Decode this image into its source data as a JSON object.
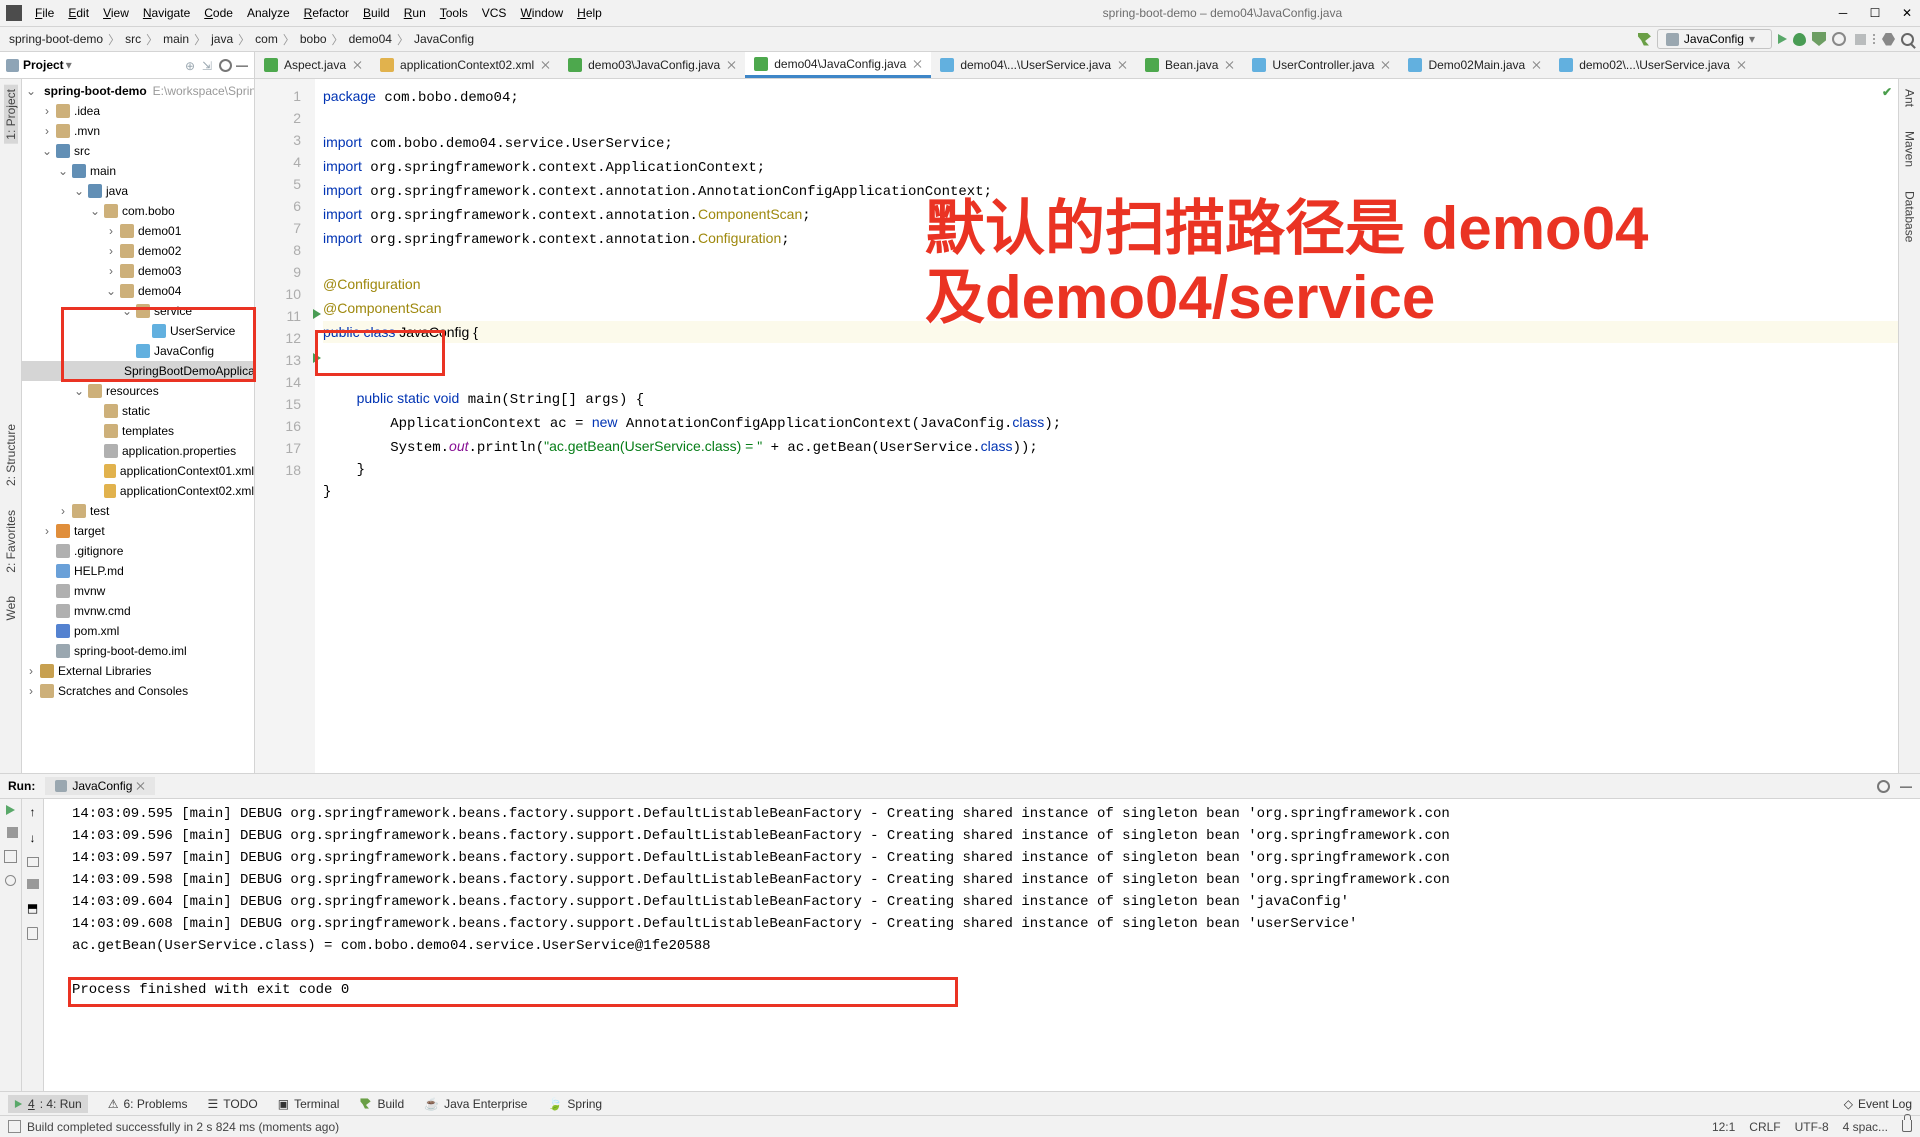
{
  "window_title": "spring-boot-demo – demo04\\JavaConfig.java",
  "menu": [
    "File",
    "Edit",
    "View",
    "Navigate",
    "Code",
    "Analyze",
    "Refactor",
    "Build",
    "Run",
    "Tools",
    "VCS",
    "Window",
    "Help"
  ],
  "menu_underline": [
    "F",
    "E",
    "V",
    "N",
    "C",
    null,
    "R",
    "B",
    "R",
    "T",
    null,
    "W",
    "H"
  ],
  "breadcrumbs": [
    "spring-boot-demo",
    "src",
    "main",
    "java",
    "com",
    "bobo",
    "demo04",
    "JavaConfig"
  ],
  "run_config": "JavaConfig",
  "project_panel_label": "Project",
  "tree": {
    "root": "spring-boot-demo",
    "root_path": "E:\\workspace\\SpringCloud",
    "idea": ".idea",
    "mvn": ".mvn",
    "src": "src",
    "main": "main",
    "java": "java",
    "combobo": "com.bobo",
    "demo01": "demo01",
    "demo02": "demo02",
    "demo03": "demo03",
    "demo04": "demo04",
    "service": "service",
    "userservice": "UserService",
    "javaconfig": "JavaConfig",
    "springbootapp": "SpringBootDemoApplication",
    "resources": "resources",
    "static": "static",
    "templates": "templates",
    "appprops": "application.properties",
    "ctx01": "applicationContext01.xml",
    "ctx02": "applicationContext02.xml",
    "test": "test",
    "target": "target",
    "gitignore": ".gitignore",
    "help": "HELP.md",
    "mvnw": "mvnw",
    "mvnwcmd": "mvnw.cmd",
    "pom": "pom.xml",
    "iml": "spring-boot-demo.iml",
    "extlib": "External Libraries",
    "scratches": "Scratches and Consoles"
  },
  "tabs": [
    {
      "label": "Aspect.java",
      "type": "jc"
    },
    {
      "label": "applicationContext02.xml",
      "type": "xml"
    },
    {
      "label": "demo03\\JavaConfig.java",
      "type": "jc"
    },
    {
      "label": "demo04\\JavaConfig.java",
      "type": "jc",
      "active": true
    },
    {
      "label": "demo04\\...\\UserService.java",
      "type": "cls"
    },
    {
      "label": "Bean.java",
      "type": "jc"
    },
    {
      "label": "UserController.java",
      "type": "cls"
    },
    {
      "label": "Demo02Main.java",
      "type": "cls"
    },
    {
      "label": "demo02\\...\\UserService.java",
      "type": "cls"
    }
  ],
  "overlay": {
    "line1": "默认的扫描路径是 demo04",
    "line2": "及demo04/service"
  },
  "code_lines": 18,
  "run_panel": {
    "title": "Run:",
    "tab": "JavaConfig"
  },
  "console_lines": [
    "14:03:09.595 [main] DEBUG org.springframework.beans.factory.support.DefaultListableBeanFactory - Creating shared instance of singleton bean 'org.springframework.con",
    "14:03:09.596 [main] DEBUG org.springframework.beans.factory.support.DefaultListableBeanFactory - Creating shared instance of singleton bean 'org.springframework.con",
    "14:03:09.597 [main] DEBUG org.springframework.beans.factory.support.DefaultListableBeanFactory - Creating shared instance of singleton bean 'org.springframework.con",
    "14:03:09.598 [main] DEBUG org.springframework.beans.factory.support.DefaultListableBeanFactory - Creating shared instance of singleton bean 'org.springframework.con",
    "14:03:09.604 [main] DEBUG org.springframework.beans.factory.support.DefaultListableBeanFactory - Creating shared instance of singleton bean 'javaConfig'",
    "14:03:09.608 [main] DEBUG org.springframework.beans.factory.support.DefaultListableBeanFactory - Creating shared instance of singleton bean 'userService'",
    "ac.getBean(UserService.class) = com.bobo.demo04.service.UserService@1fe20588",
    "",
    "Process finished with exit code 0"
  ],
  "bottom": {
    "run": "4: Run",
    "problems": "6: Problems",
    "todo": "TODO",
    "terminal": "Terminal",
    "build": "Build",
    "je": "Java Enterprise",
    "spring": "Spring",
    "eventlog": "Event Log"
  },
  "status": {
    "msg": "Build completed successfully in 2 s 824 ms (moments ago)",
    "pos": "12:1",
    "crlf": "CRLF",
    "enc": "UTF-8",
    "spaces": "4 spac..."
  },
  "left_rail": [
    "1: Project",
    "2: Structure",
    "2: Favorites",
    "Web"
  ],
  "right_rail": [
    "Ant",
    "Maven",
    "Database"
  ]
}
